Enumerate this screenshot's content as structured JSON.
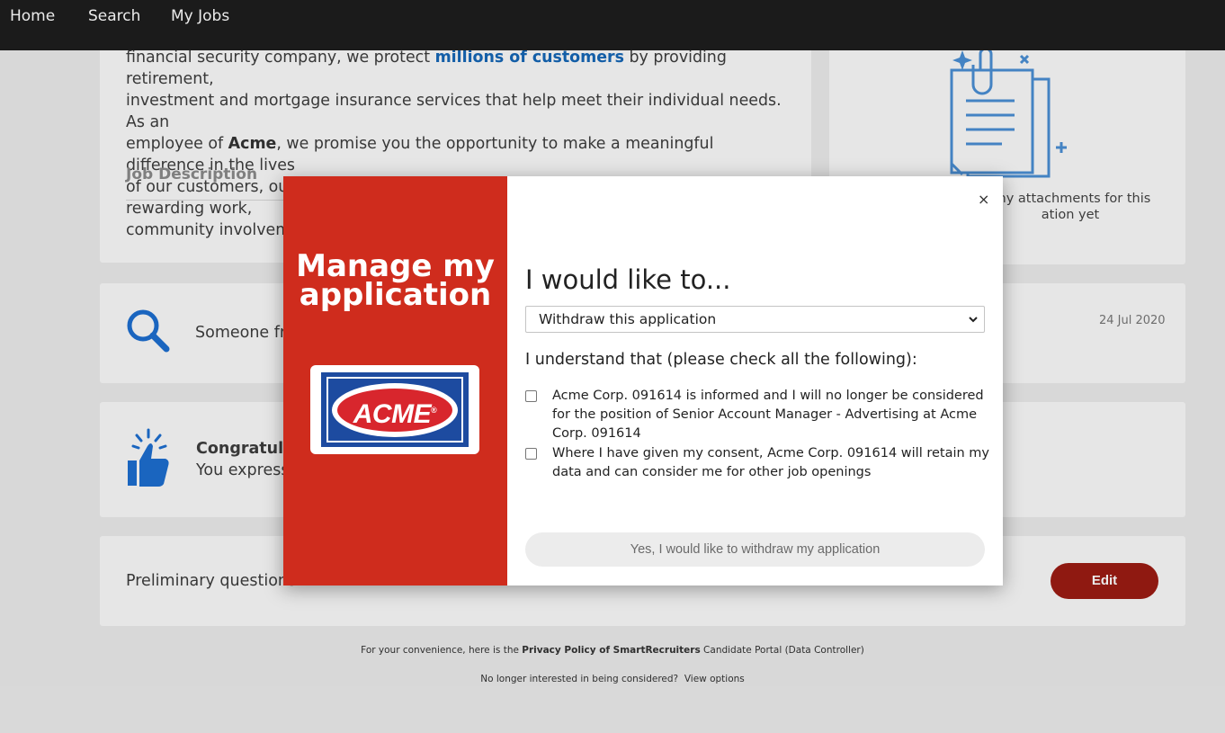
{
  "nav": {
    "home": "Home",
    "search": "Search",
    "my_jobs": "My Jobs"
  },
  "about": {
    "line1_a": "financial security company, we protect ",
    "line1_hl": "millions of customers",
    "line1_b": " by providing retirement,",
    "line2": "investment and mortgage insurance services that help meet their individual needs. As an",
    "line3_a": "employee of ",
    "line3_bold": "Acme",
    "line3_b": ", we promise you the opportunity to make a meaningful difference in the lives",
    "line4": "of our customers, our communities, and one another. We believe in camaraderie, rewarding work,",
    "line5": "community involvement and a focus on your well-being.",
    "job_description": "Job Description"
  },
  "attachments": {
    "text": "any attachments for this",
    "text2": "ation yet"
  },
  "activity": {
    "viewed_text": "Someone fro",
    "viewed_date": "24 Jul 2020",
    "congrats_title": "Congratulat",
    "congrats_text": "You expresse"
  },
  "questions": {
    "label": "Preliminary questions",
    "edit": "Edit"
  },
  "footer": {
    "line1_a": "For your convenience, here is the ",
    "line1_bold": "Privacy Policy of SmartRecruiters",
    "line1_b": " Candidate Portal (Data Controller)",
    "line2_a": "No longer interested in being considered?",
    "line2_link": "View options"
  },
  "modal": {
    "left_title_1": "Manage my",
    "left_title_2": "application",
    "logo_text": "ACME",
    "logo_reg": "®",
    "close": "×",
    "heading": "I would like to...",
    "select_value": "Withdraw this application",
    "understand": "I understand that (please check all the following):",
    "check1": "Acme Corp. 091614 is informed and I will no longer be considered for the position of Senior Account Manager - Advertising at Acme Corp. 091614",
    "check2": "Where I have given my consent, Acme Corp. 091614 will retain my data and can consider me for other job openings",
    "withdraw_button": "Yes, I would like to withdraw my application"
  },
  "colors": {
    "nav_bg": "#1e1e1e",
    "brand_red": "#cf2c1d",
    "edit_red": "#9c1c13",
    "link_blue": "#1566b6",
    "acme_blue": "#1d4ba0"
  },
  "icons": [
    "search-icon",
    "thumbs-up-icon",
    "attachments-icon",
    "close-icon",
    "chevron-down-icon"
  ]
}
